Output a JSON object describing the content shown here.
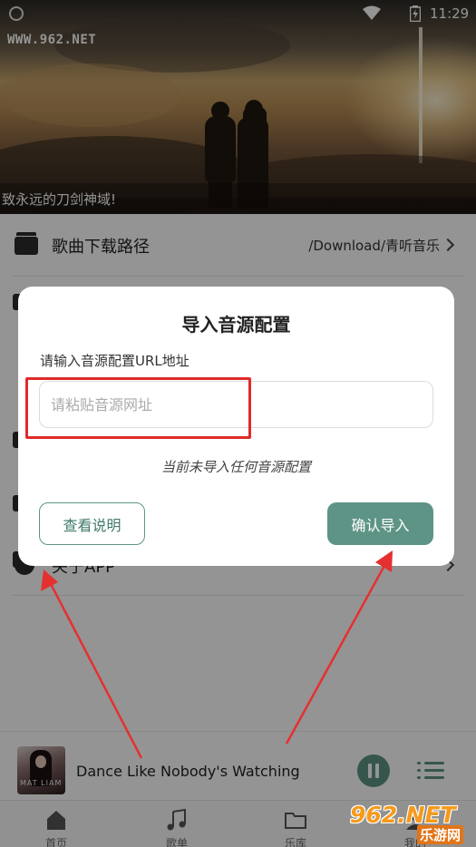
{
  "status_bar": {
    "time": "11:29"
  },
  "banner": {
    "watermark": "WWW.962.NET",
    "caption": "致永远的刀剑神域!"
  },
  "settings": {
    "download_path": {
      "label": "歌曲下载路径",
      "value": "/Download/青听音乐"
    },
    "about_partial": "关于APP"
  },
  "player": {
    "song_title": "Dance Like Nobody's Watching",
    "cover_text": "MAT LIAM"
  },
  "bottom_nav": [
    {
      "label": "首页",
      "icon": "home-icon"
    },
    {
      "label": "歌单",
      "icon": "music-note-icon"
    },
    {
      "label": "乐库",
      "icon": "folder-icon"
    },
    {
      "label": "我的",
      "icon": "user-icon"
    }
  ],
  "dialog": {
    "title": "导入音源配置",
    "field_label": "请输入音源配置URL地址",
    "input_placeholder": "请粘贴音源网址",
    "input_value": "",
    "status_text": "当前未导入任何音源配置",
    "help_button": "查看说明",
    "confirm_button": "确认导入"
  },
  "watermark_logo": {
    "main": "962.NET",
    "sub": "乐游网"
  },
  "colors": {
    "accent": "#5d9486",
    "annotation": "#e02a2a",
    "watermark_orange": "#f59a1b"
  }
}
